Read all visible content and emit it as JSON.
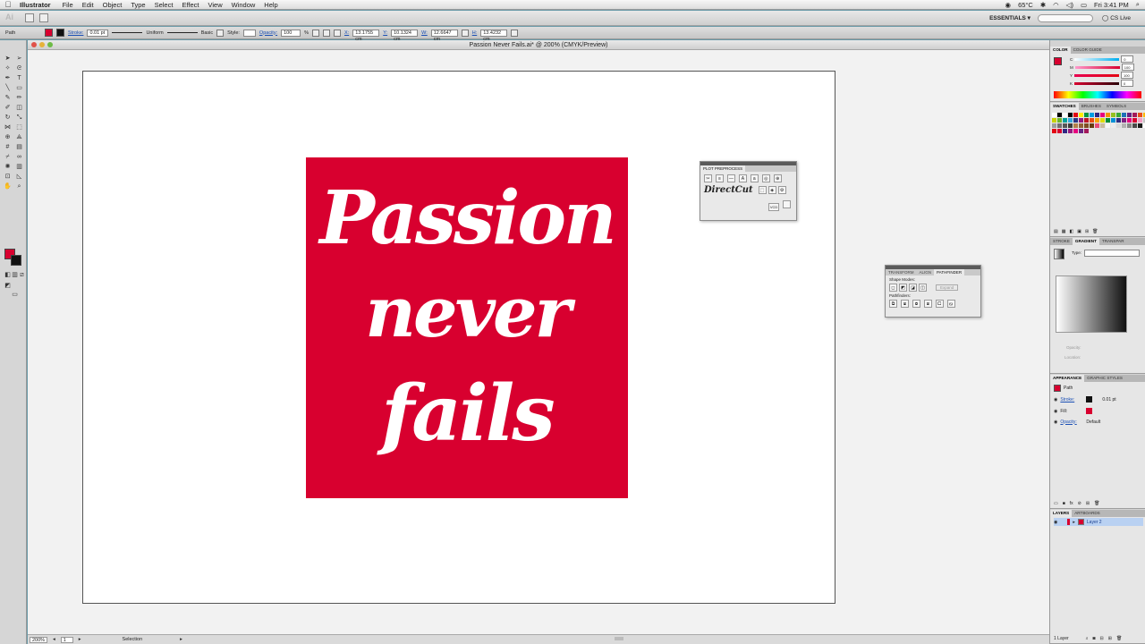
{
  "menubar": {
    "apple": "",
    "app_name": "Illustrator",
    "items": [
      "File",
      "Edit",
      "Object",
      "Type",
      "Select",
      "Effect",
      "View",
      "Window",
      "Help"
    ],
    "temperature": "65°C",
    "clock": "Fri 3:41 PM"
  },
  "appbar": {
    "logo": "Ai",
    "workspace": "ESSENTIALS ▾",
    "cs_live": "CS Live"
  },
  "controlbar": {
    "selection_type": "Path",
    "stroke_label": "Stroke:",
    "stroke_value": "0.01 pt",
    "profile": "Uniform",
    "brush": "Basic",
    "style_label": "Style:",
    "opacity_label": "Opacity:",
    "opacity_value": "100",
    "opacity_unit": "%",
    "x_label": "X:",
    "x_value": "13.1755 cm",
    "y_label": "Y:",
    "y_value": "10.1324 cm",
    "w_label": "W:",
    "w_value": "12.6647 cm",
    "h_label": "H:",
    "h_value": "13.4232 cm"
  },
  "document": {
    "title": "Passion Never Fails.ai* @ 200% (CMYK/Preview)",
    "artwork_lines": [
      "Passion",
      "never",
      "fails"
    ],
    "artwork_color": "#d8002f"
  },
  "statusbar": {
    "zoom": "200%",
    "artboard_num": "1",
    "tool_name": "Selection"
  },
  "plot_panel": {
    "title": "PLOT PREPROCESS",
    "brand": "DirectCut",
    "vcd": "VCD"
  },
  "pathfinder_panel": {
    "tabs": [
      "TRANSFORM",
      "ALIGN",
      "PATHFINDER"
    ],
    "shape_modes": "Shape Modes:",
    "expand": "Expand",
    "pathfinders": "Pathfinders:"
  },
  "color_panel": {
    "tabs": [
      "COLOR",
      "COLOR GUIDE"
    ],
    "labels": [
      "C",
      "M",
      "Y",
      "K"
    ],
    "values": [
      "0",
      "100",
      "100",
      "0"
    ]
  },
  "swatches_panel": {
    "tabs": [
      "SWATCHES",
      "BRUSHES",
      "SYMBOLS"
    ]
  },
  "gradient_panel": {
    "tabs": [
      "STROKE",
      "GRADIENT",
      "TRANSPAR"
    ],
    "type_label": "Type:",
    "opacity_label": "Opacity:",
    "location_label": "Location:"
  },
  "appearance_panel": {
    "tabs": [
      "APPEARANCE",
      "GRAPHIC STYLES"
    ],
    "object": "Path",
    "stroke_label": "Stroke:",
    "stroke_value": "0.01 pt",
    "fill_label": "Fill:",
    "opacity_label": "Opacity:",
    "opacity_value": "Default"
  },
  "layers_panel": {
    "tabs": [
      "LAYERS",
      "ARTBOARDS"
    ],
    "layer_name": "Layer 2",
    "footer": "1 Layer"
  }
}
